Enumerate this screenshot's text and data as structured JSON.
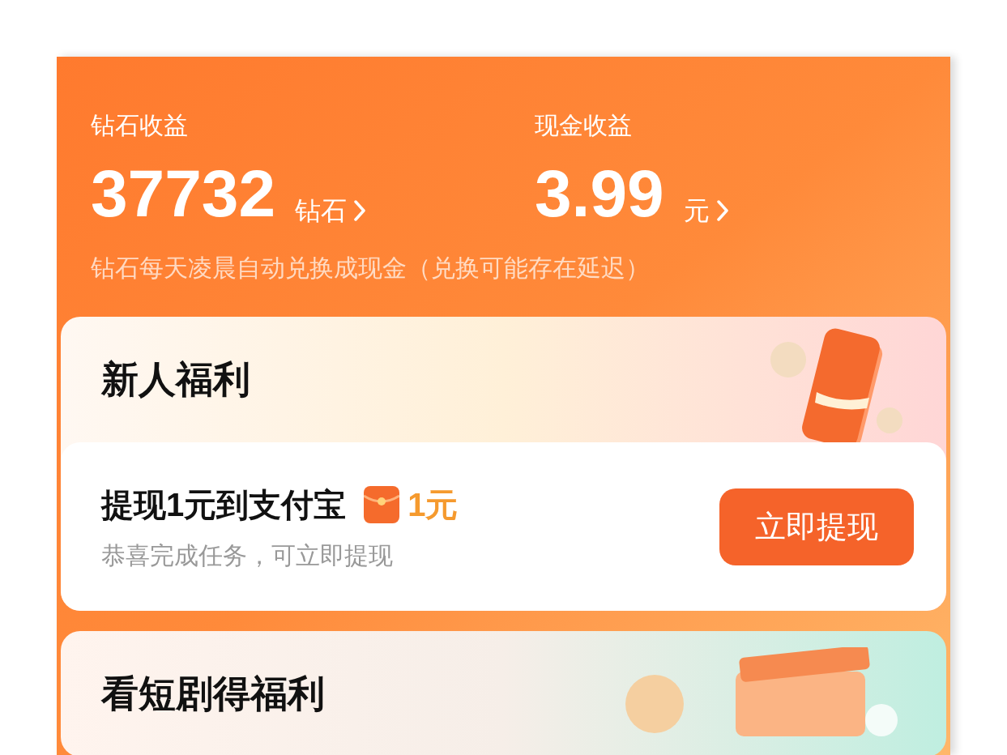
{
  "earnings": [
    {
      "label": "钻石收益",
      "value": "37732",
      "unit": "钻石"
    },
    {
      "label": "现金收益",
      "value": "3.99",
      "unit": "元"
    }
  ],
  "note": "钻石每天凌晨自动兑换成现金（兑换可能存在延迟）",
  "sections": [
    {
      "title": "新人福利",
      "kind": "red-packet",
      "task": {
        "title": "提现1元到支付宝",
        "reward": "1元",
        "subtitle": "恭喜完成任务，可立即提现",
        "button": "立即提现"
      }
    },
    {
      "title": "看短剧得福利",
      "kind": "video"
    }
  ]
}
